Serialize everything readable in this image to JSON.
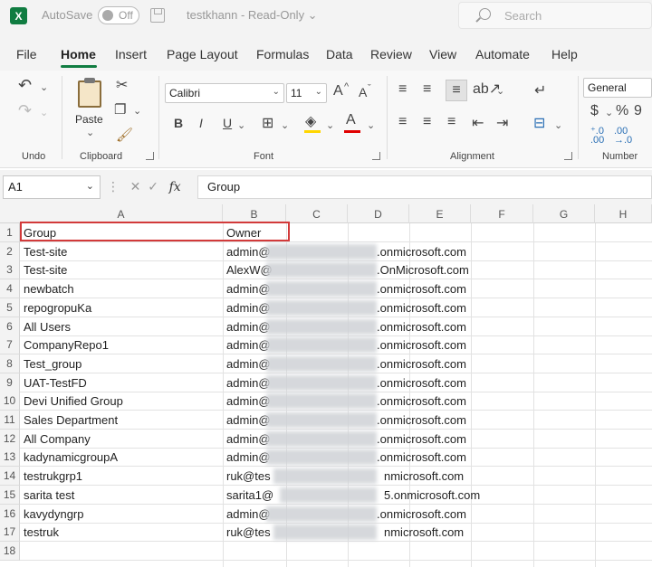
{
  "titlebar": {
    "app_letter": "X",
    "autosave_label": "AutoSave",
    "autosave_state": "Off",
    "document_title": "testkhann  -  Read-Only  ⌄",
    "search_placeholder": "Search"
  },
  "menu": {
    "tabs": [
      "File",
      "Home",
      "Insert",
      "Page Layout",
      "Formulas",
      "Data",
      "Review",
      "View",
      "Automate",
      "Help"
    ],
    "active_tab": "Home"
  },
  "ribbon": {
    "groups": {
      "undo": "Undo",
      "clipboard": "Clipboard",
      "font": "Font",
      "alignment": "Alignment",
      "number": "Number"
    },
    "paste_label": "Paste",
    "font_name": "Calibri",
    "font_size": "11",
    "number_format": "General",
    "bold": "B",
    "italic": "I",
    "underline": "U",
    "currency": "$",
    "percent": "%",
    "comma": "9",
    "grow_font": "A",
    "shrink_font": "A",
    "font_color": "A",
    "dec_increase": "⁺.0\n.00",
    "dec_decrease": ".00\n→.0",
    "fill_color_hex": "#ffd600",
    "font_color_hex": "#e00000"
  },
  "formula_bar": {
    "cell_ref": "A1",
    "fx_label": "fx",
    "value": "Group"
  },
  "grid": {
    "columns": [
      "A",
      "B",
      "C",
      "D",
      "E",
      "F",
      "G",
      "H"
    ],
    "rows": [
      {
        "num": "1",
        "a": "Group",
        "b": "Owner",
        "b_suffix": ""
      },
      {
        "num": "2",
        "a": "Test-site",
        "b": "admin@",
        "b_suffix": ".onmicrosoft.com"
      },
      {
        "num": "3",
        "a": "Test-site",
        "b": "AlexW@",
        "b_suffix": ".OnMicrosoft.com"
      },
      {
        "num": "4",
        "a": "newbatch",
        "b": "admin@",
        "b_suffix": ".onmicrosoft.com"
      },
      {
        "num": "5",
        "a": "repogropuKa",
        "b": "admin@",
        "b_suffix": ".onmicrosoft.com"
      },
      {
        "num": "6",
        "a": "All Users",
        "b": "admin@",
        "b_suffix": ".onmicrosoft.com"
      },
      {
        "num": "7",
        "a": "CompanyRepo1",
        "b": "admin@",
        "b_suffix": ".onmicrosoft.com"
      },
      {
        "num": "8",
        "a": "Test_group",
        "b": "admin@",
        "b_suffix": ".onmicrosoft.com"
      },
      {
        "num": "9",
        "a": "UAT-TestFD",
        "b": "admin@",
        "b_suffix": ".onmicrosoft.com"
      },
      {
        "num": "10",
        "a": "Devi Unified Group",
        "b": "admin@",
        "b_suffix": ".onmicrosoft.com"
      },
      {
        "num": "11",
        "a": "Sales Department",
        "b": "admin@",
        "b_suffix": ".onmicrosoft.com"
      },
      {
        "num": "12",
        "a": "All Company",
        "b": "admin@",
        "b_suffix": ".onmicrosoft.com"
      },
      {
        "num": "13",
        "a": "kadynamicgroupA",
        "b": "admin@",
        "b_suffix": ".onmicrosoft.com"
      },
      {
        "num": "14",
        "a": "testrukgrp1",
        "b": "ruk@tes",
        "b_suffix": "nmicrosoft.com"
      },
      {
        "num": "15",
        "a": "sarita test",
        "b": "sarita1@",
        "b_suffix": "5.onmicrosoft.com"
      },
      {
        "num": "16",
        "a": "kavydyngrp",
        "b": "admin@",
        "b_suffix": ".onmicrosoft.com"
      },
      {
        "num": "17",
        "a": "testruk",
        "b": "ruk@tes",
        "b_suffix": "nmicrosoft.com"
      },
      {
        "num": "18",
        "a": "",
        "b": "",
        "b_suffix": ""
      }
    ]
  }
}
